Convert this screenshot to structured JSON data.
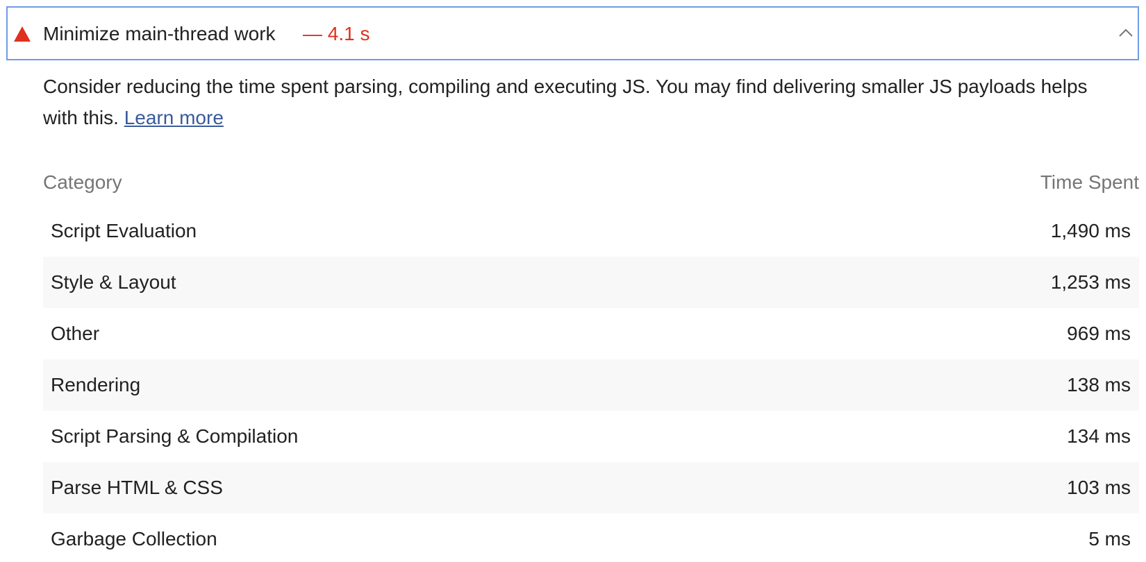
{
  "audit": {
    "title": "Minimize main-thread work",
    "value": "— 4.1 s",
    "status_color": "#e0301e",
    "status_icon": "warning-triangle-icon",
    "toggle_icon": "chevron-up-icon"
  },
  "description": {
    "text": "Consider reducing the time spent parsing, compiling and executing JS. You may find delivering smaller JS payloads helps with this. ",
    "link_label": "Learn more"
  },
  "table": {
    "headers": {
      "category": "Category",
      "time": "Time Spent"
    },
    "rows": [
      {
        "category": "Script Evaluation",
        "time": "1,490 ms"
      },
      {
        "category": "Style & Layout",
        "time": "1,253 ms"
      },
      {
        "category": "Other",
        "time": "969 ms"
      },
      {
        "category": "Rendering",
        "time": "138 ms"
      },
      {
        "category": "Script Parsing & Compilation",
        "time": "134 ms"
      },
      {
        "category": "Parse HTML & CSS",
        "time": "103 ms"
      },
      {
        "category": "Garbage Collection",
        "time": "5 ms"
      }
    ]
  }
}
